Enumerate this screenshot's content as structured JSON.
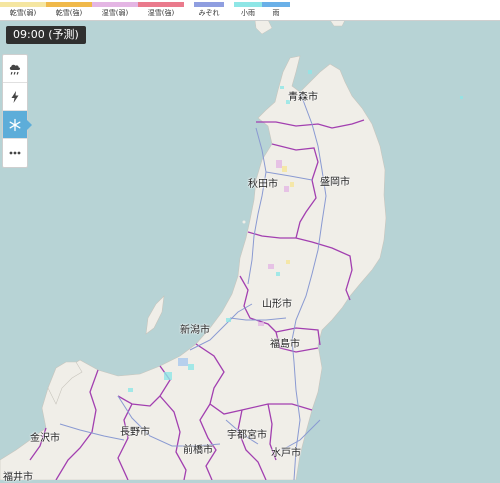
{
  "legend": {
    "groups": [
      {
        "items": [
          {
            "label": "乾雪(弱)",
            "color": "#f5e6a1"
          },
          {
            "label": "乾雪(強)",
            "color": "#f0b94a"
          },
          {
            "label": "湿雪(弱)",
            "color": "#e4b6e4"
          },
          {
            "label": "湿雪(強)",
            "color": "#ea7a8c"
          }
        ]
      },
      {
        "items": [
          {
            "label": "みぞれ",
            "color": "#8f9ee0"
          }
        ]
      },
      {
        "items": [
          {
            "label": "小雨",
            "color": "#8ee6e6"
          },
          {
            "label": "雨",
            "color": "#6ab0e8"
          }
        ]
      }
    ]
  },
  "time_label": "09:00 (予測)",
  "toolbar": {
    "buttons": [
      {
        "name": "rain-cloud-icon",
        "active": false
      },
      {
        "name": "lightning-icon",
        "active": false
      },
      {
        "name": "snow-icon",
        "active": true
      },
      {
        "name": "more-icon",
        "active": false
      }
    ]
  },
  "cities": [
    {
      "name": "青森市"
    },
    {
      "name": "秋田市"
    },
    {
      "name": "盛岡市"
    },
    {
      "name": "山形市"
    },
    {
      "name": "新潟市"
    },
    {
      "name": "福島市"
    },
    {
      "name": "金沢市"
    },
    {
      "name": "長野市"
    },
    {
      "name": "宇都宮市"
    },
    {
      "name": "前橋市"
    },
    {
      "name": "水戸市"
    },
    {
      "name": "福井市"
    }
  ],
  "colors": {
    "sea": "#b7d3d5",
    "land": "#f0eee8",
    "border": "#a23fb0",
    "road": "#8a9ad2",
    "active_tool": "#5dadd9"
  }
}
